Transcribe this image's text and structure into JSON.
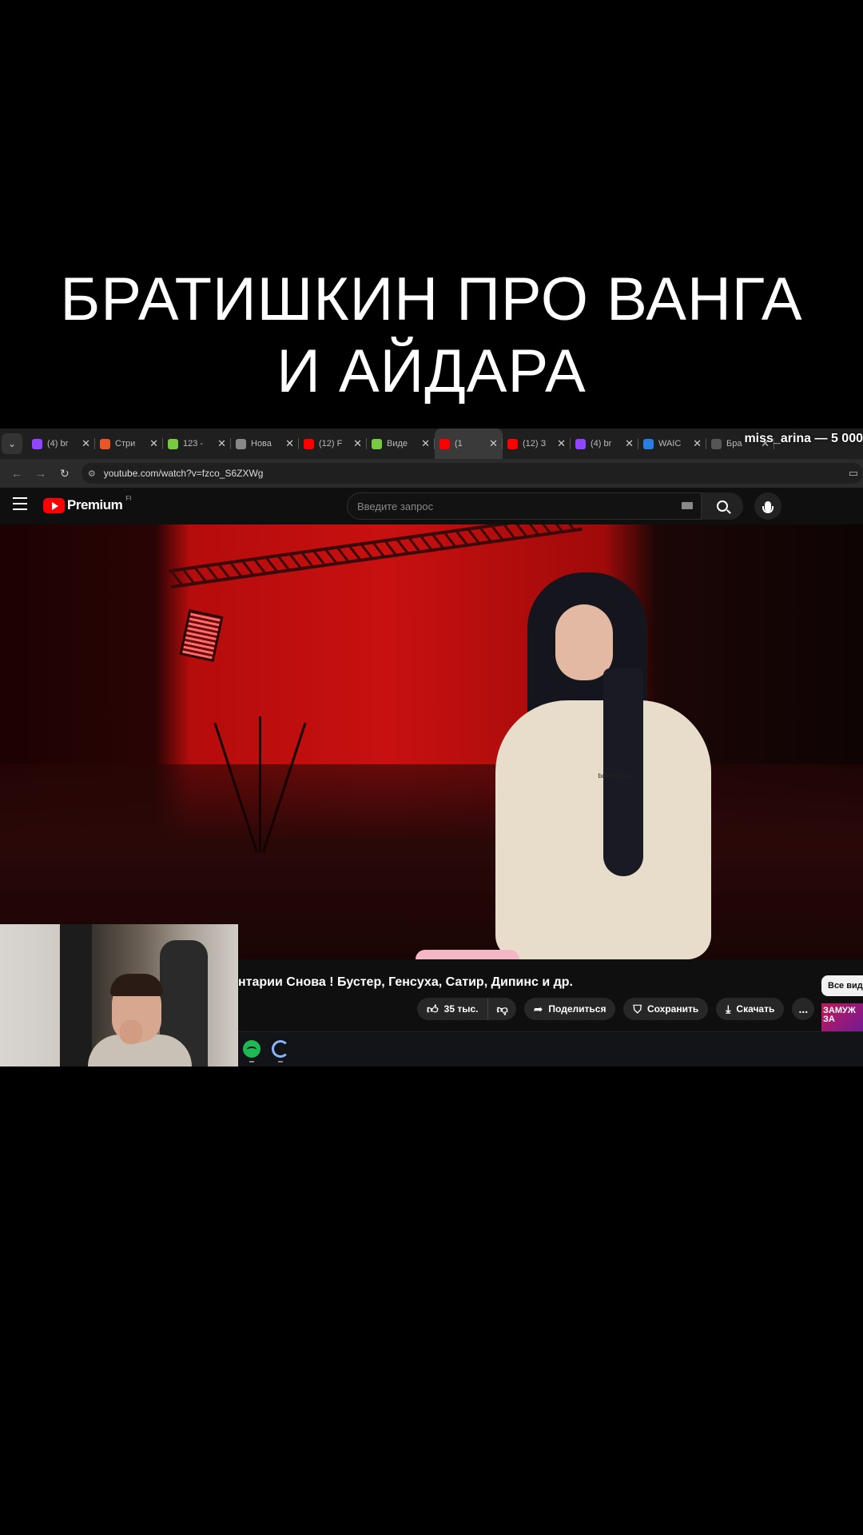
{
  "headline": {
    "line1": "БРАТИШКИН ПРО ВАНГА",
    "line2": "И АЙДАРА"
  },
  "tabbar": {
    "dropdown_icon": "chevron-down-icon",
    "tabs": [
      {
        "label": "(4) br",
        "favicon": "twitch",
        "color": "#9146ff"
      },
      {
        "label": "Стри",
        "favicon": "donation",
        "color": "#e8572a"
      },
      {
        "label": "123 -",
        "favicon": "battery",
        "color": "#7ac943"
      },
      {
        "label": "Нова",
        "favicon": "globe",
        "color": "#888888"
      },
      {
        "label": "(12) F",
        "favicon": "youtube",
        "color": "#ff0000"
      },
      {
        "label": "Виде",
        "favicon": "battery",
        "color": "#7ac943"
      },
      {
        "label": "(1",
        "favicon": "youtube",
        "color": "#ff0000",
        "active": true
      },
      {
        "label": "(12) З",
        "favicon": "youtube",
        "color": "#ff0000"
      },
      {
        "label": "(4) br",
        "favicon": "twitch",
        "color": "#9146ff"
      },
      {
        "label": "WAIC",
        "favicon": "w",
        "color": "#2a7de1"
      },
      {
        "label": "Бра",
        "favicon": "fp",
        "color": "#555555"
      }
    ],
    "overlay_text": "miss_arina — 5 000"
  },
  "addressbar": {
    "url": "youtube.com/watch?v=fzco_S6ZXWg"
  },
  "youtube": {
    "logo_text": "Premium",
    "region": "FI",
    "search_placeholder": "Введите запрос",
    "video_title": "нтарии Снова ! Бустер, Генсуха, Сатир, Дипинс и др.",
    "actions": {
      "likes": "35 тыс.",
      "share": "Поделиться",
      "save": "Сохранить",
      "download": "Скачать",
      "more": "..."
    },
    "chip_label": "Все вид",
    "thumb_text": "ЗАМУЖ ЗА",
    "brand_on_shirt": "balenciaga"
  },
  "colors": {
    "background": "#000000",
    "youtube_red": "#ff0000",
    "pill_bg": "#272727"
  }
}
